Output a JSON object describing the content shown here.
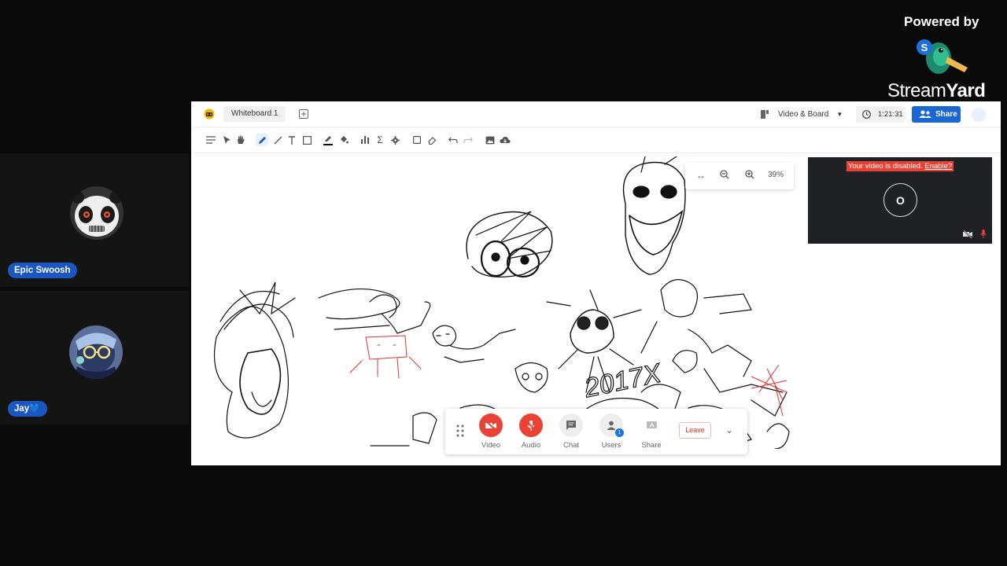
{
  "branding": {
    "powered_by": "Powered by",
    "logo_word_light": "Stream",
    "logo_word_bold": "Yard",
    "logo_icon": "streamyard-duck-icon"
  },
  "participants": [
    {
      "name": "Epic Swoosh",
      "avatar": "panda-avatar"
    },
    {
      "name": "Jay💙",
      "avatar": "glasses-avatar"
    }
  ],
  "whiteboard": {
    "tab_label": "Whiteboard 1",
    "view_mode": "Video & Board",
    "timer": "1:21:31",
    "share_label": "Share",
    "zoom_percent": "39%",
    "video_panel": {
      "message": "Your video is disabled.",
      "enable_link": "Enable?",
      "initial": "O"
    },
    "call_bar": {
      "video_label": "Video",
      "audio_label": "Audio",
      "chat_label": "Chat",
      "users_label": "Users",
      "users_count": "1",
      "share_label": "Share",
      "leave_label": "Leave"
    },
    "doodle_text": "2017X"
  },
  "colors": {
    "stage_bg": "#0a0a0a",
    "name_tag": "#1a56c4",
    "share_button": "#1967d2",
    "video_off_red": "#ea4335",
    "video_panel_bg": "#202124"
  }
}
